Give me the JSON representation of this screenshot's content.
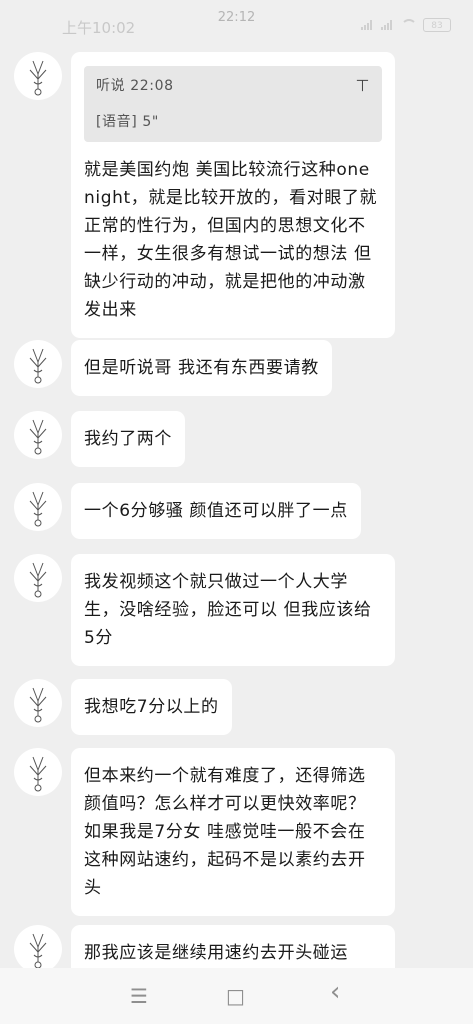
{
  "status_bar": {
    "time": "上午10:02",
    "center_time": "22:12",
    "battery": "83"
  },
  "quote": {
    "title": "听说 22:08",
    "body": "[语音] 5\"",
    "icon": "pin-top-icon"
  },
  "messages": [
    {
      "text": "就是美国约炮 美国比较流行这种one night，就是比较开放的，看对眼了就正常的性行为，但国内的思想文化不一样，女生很多有想试一试的想法 但缺少行动的冲动，就是把他的冲动激发出来"
    },
    {
      "text": "但是听说哥 我还有东西要请教"
    },
    {
      "text": "我约了两个"
    },
    {
      "text": "一个6分够骚 颜值还可以胖了一点"
    },
    {
      "text": "我发视频这个就只做过一个人大学生，没啥经验，脸还可以 但我应该给5分"
    },
    {
      "text": "我想吃7分以上的"
    },
    {
      "text": "但本来约一个就有难度了，还得筛选颜值吗？怎么样才可以更快效率呢？ 如果我是7分女 哇感觉哇一般不会在这种网站速约，起码不是以素约去开头"
    },
    {
      "text": "那我应该是继续用速约去开头碰运"
    }
  ],
  "nav": {
    "menu_icon": "☰",
    "home_icon": "□",
    "back_icon": "‹"
  }
}
